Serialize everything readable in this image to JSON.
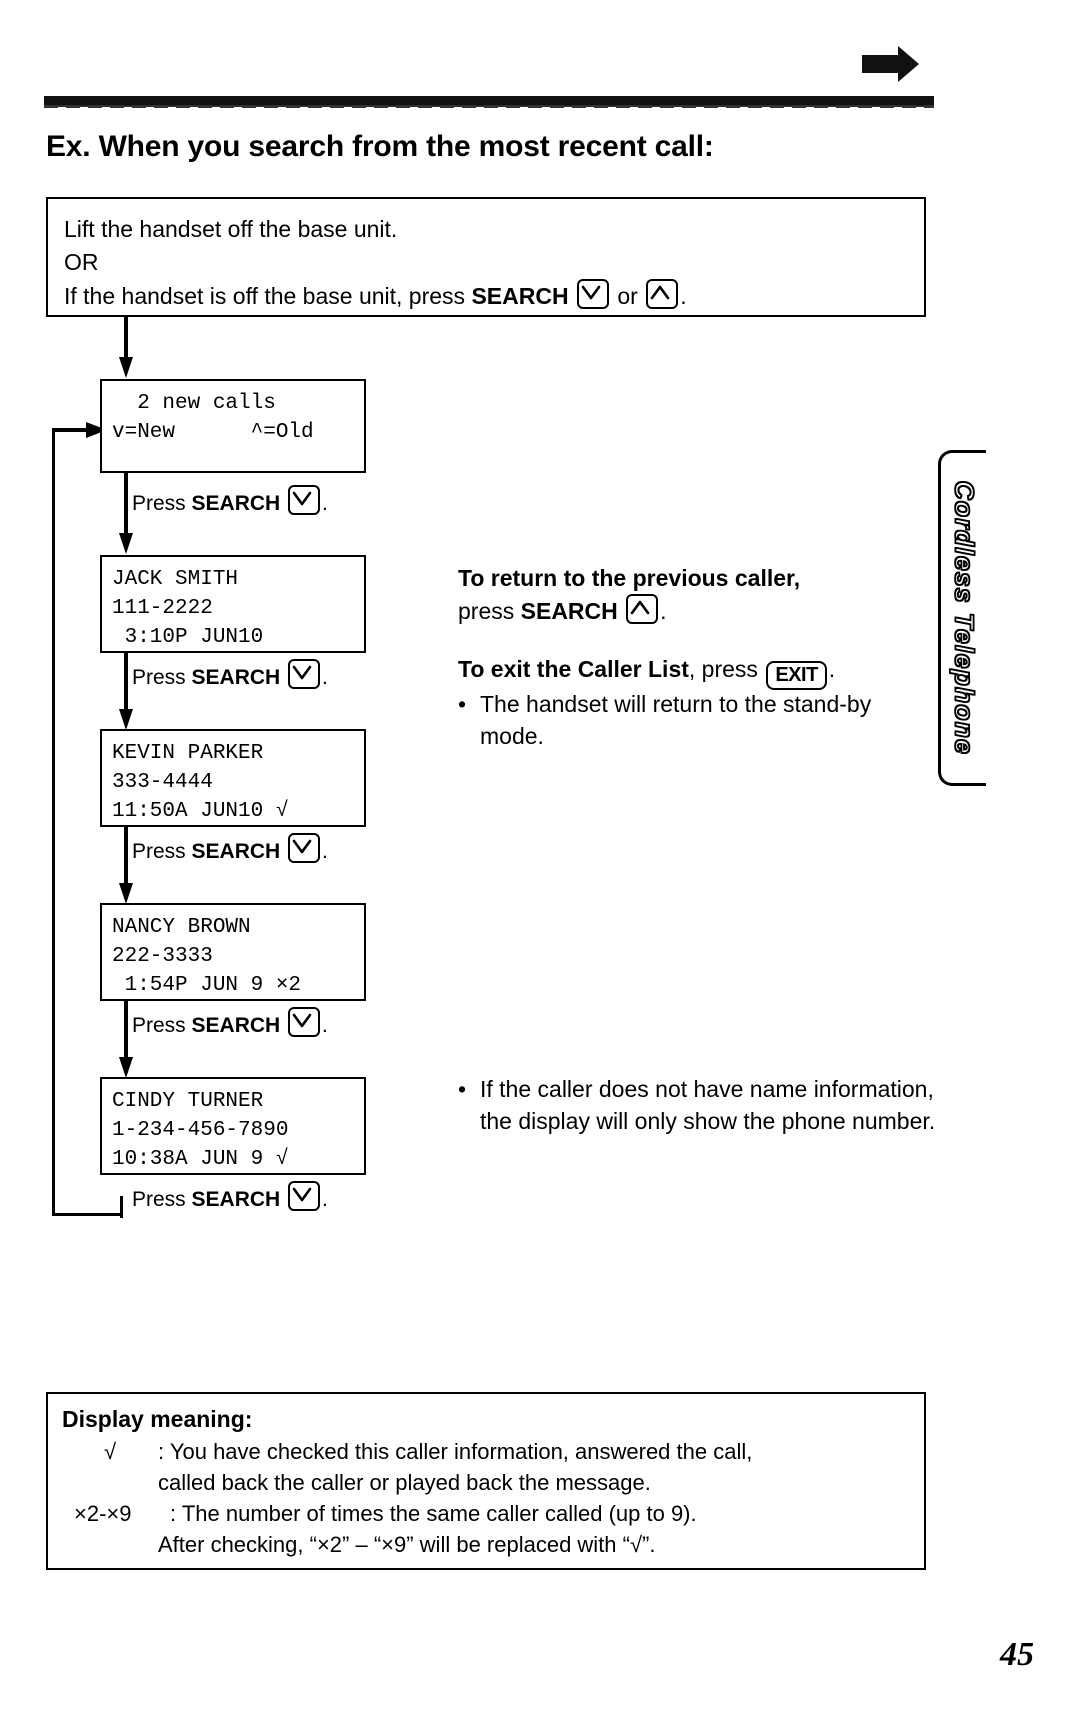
{
  "page": {
    "number": "45",
    "side_tab_label": "Cordless Telephone",
    "heading": "Ex. When you search from the most recent call:"
  },
  "intro": {
    "line1": "Lift the handset off the base unit.",
    "line2": "OR",
    "line3_pre": "If the handset is off the base unit, press ",
    "line3_search": "SEARCH",
    "line3_mid": " or ",
    "line3_end": "."
  },
  "flow": {
    "press_label_pre": "Press ",
    "press_label_bold": "SEARCH",
    "press_label_post": ".",
    "screens": [
      {
        "name": "new-calls-summary",
        "line1": "  2 new calls",
        "line2": "v=New      ^=Old",
        "line3": ""
      },
      {
        "name": "caller-jack-smith",
        "line1": "JACK SMITH",
        "line2": "111-2222",
        "line3": " 3:10P JUN10"
      },
      {
        "name": "caller-kevin-parker",
        "line1": "KEVIN PARKER",
        "line2": "333-4444",
        "line3": "11:50A JUN10 √"
      },
      {
        "name": "caller-nancy-brown",
        "line1": "NANCY BROWN",
        "line2": "222-3333",
        "line3": " 1:54P JUN 9 ×2"
      },
      {
        "name": "caller-cindy-turner",
        "line1": "CINDY TURNER",
        "line2": "1-234-456-7890",
        "line3": "10:38A JUN 9 √"
      }
    ]
  },
  "notes": {
    "return_bold": "To return to the previous caller,",
    "return_rest_pre": "press ",
    "return_rest_search": "SEARCH",
    "return_rest_post": ".",
    "exit_bold": "To exit the Caller List",
    "exit_rest": ", press ",
    "exit_key": "EXIT",
    "exit_period": ".",
    "exit_bullet": "The handset will return to the stand-by mode.",
    "no_name_bullet": "If the caller does not have name information, the display will only show the phone number."
  },
  "meaning": {
    "title": "Display meaning:",
    "rows": [
      {
        "symbol": "√",
        "text": ": You have checked this caller information, answered the call,",
        "cont": "called back the caller or played back the message."
      },
      {
        "symbol": "×2-×9",
        "text": ": The number of times the same caller called (up to 9).",
        "cont": "After checking, “×2” – “×9” will be replaced with “√”."
      }
    ]
  },
  "icons": {
    "arrow_right": "arrow-right-icon",
    "search_down": "search-down-key-icon",
    "search_up": "search-up-key-icon",
    "exit": "exit-key-icon"
  }
}
